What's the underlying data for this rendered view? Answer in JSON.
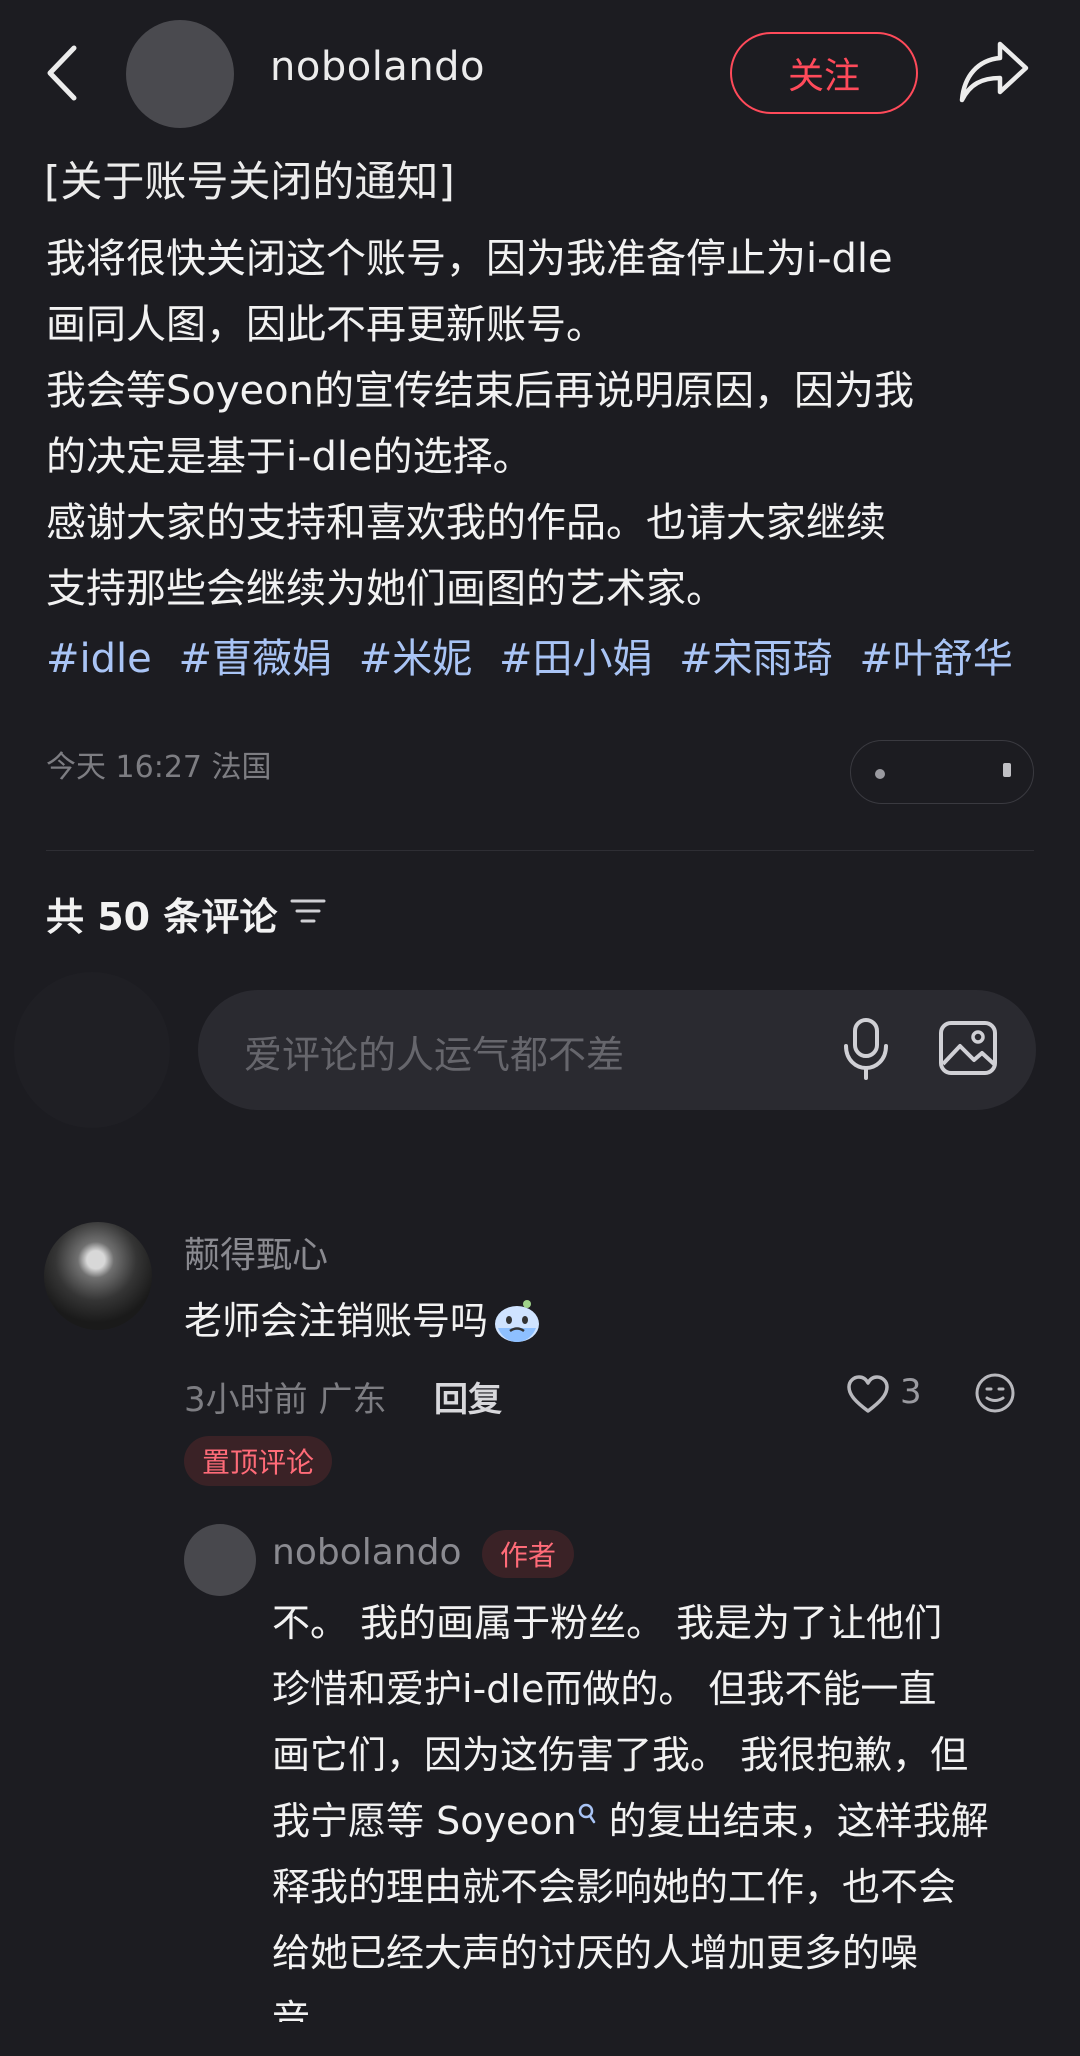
{
  "header": {
    "username": "nobolando",
    "follow_label": "关注"
  },
  "post": {
    "title": "[关于账号关闭的通知]",
    "body_lines": [
      "我将很快关闭这个账号，因为我准备停止为i-dle",
      "画同人图，因此不再更新账号。",
      "我会等Soyeon的宣传结束后再说明原因，因为我",
      "的决定是基于i-dle的选择。",
      "感谢大家的支持和喜欢我的作品。也请大家继续",
      "支持那些会继续为她们画图的艺术家。"
    ],
    "tags": [
      "#idle",
      "#曺薇娟",
      "#米妮",
      "#田小娟",
      "#宋雨琦",
      "#叶舒华"
    ],
    "meta": "今天 16:27 法国"
  },
  "comments_section": {
    "count_label": "共 50 条评论",
    "input_placeholder": "爱评论的人运气都不差"
  },
  "comment1": {
    "name": "颟得甄心",
    "text": "老师会注销账号吗",
    "meta": "3小时前 广东",
    "reply_label": "回复",
    "likes": "3",
    "pinned_label": "置顶评论"
  },
  "reply1": {
    "name": "nobolando",
    "author_label": "作者",
    "lines": [
      "不。 我的画属于粉丝。 我是为了让他们",
      "珍惜和爱护i-dle而做的。 但我不能一直",
      "画它们，因为这伤害了我。 我很抱歉，但",
      "我宁愿等 Soyeon",
      " 的复出结束，这样我解",
      "释我的理由就不会影响她的工作，也不会",
      "给她已经大声的讨厌的人增加更多的噪",
      "音。"
    ]
  },
  "icons": {
    "back": "chevron-left-icon",
    "share": "share-arrow-icon",
    "sort": "sort-lines-icon",
    "mic": "microphone-icon",
    "image": "image-icon",
    "heart": "heart-icon",
    "emoji": "emoji-face-icon"
  },
  "colors": {
    "background": "#1c1c21",
    "accent": "#ff4a5a",
    "tag": "#a9c4f5"
  }
}
